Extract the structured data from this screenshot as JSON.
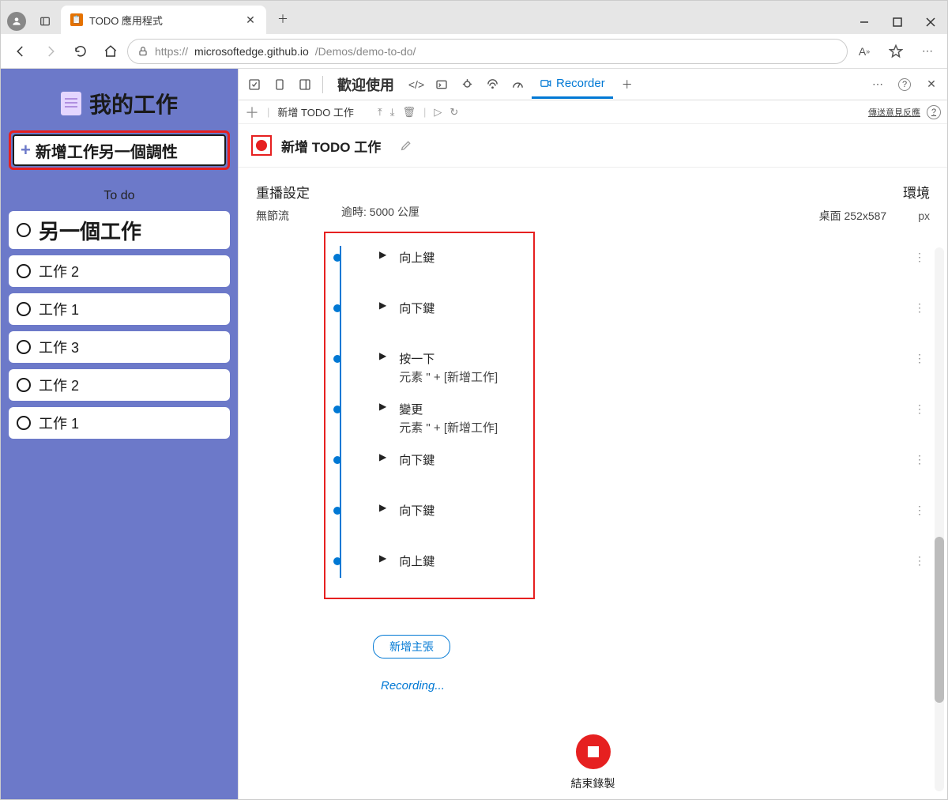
{
  "browser": {
    "tab_title": "TODO 應用程式",
    "url_scheme": "https://",
    "url_host": "microsoftedge.github.io",
    "url_path": "/Demos/demo-to-do/"
  },
  "todo": {
    "header": "我的工作",
    "add_text": "新增工作另一個調性",
    "section": "To do",
    "items": [
      {
        "label": "另一個工作",
        "featured": true
      },
      {
        "label": "工作 2",
        "featured": false
      },
      {
        "label": "工作 1",
        "featured": false
      },
      {
        "label": "工作 3",
        "featured": false
      },
      {
        "label": "工作 2",
        "featured": false
      },
      {
        "label": "工作 1",
        "featured": false
      }
    ]
  },
  "devtools": {
    "welcome_tab": "歡迎使用",
    "recorder_tab": "Recorder",
    "sub_label": "新增 TODO 工作",
    "feedback": "傳送意見反應",
    "recording_name": "新增 TODO 工作",
    "replay_settings_label": "重播設定",
    "no_throttle": "無節流",
    "timeout": "逾時: 5000 公厘",
    "env_label": "環境",
    "env_desktop": "桌面",
    "env_size": "252x587",
    "env_unit": "px",
    "steps": [
      {
        "text": "向上鍵",
        "sub": ""
      },
      {
        "text": "向下鍵",
        "sub": ""
      },
      {
        "text": "按一下",
        "sub": "元素 \" +      [新增工作]"
      },
      {
        "text": "變更",
        "sub": "元素 \" +      [新增工作]"
      },
      {
        "text": "向下鍵",
        "sub": ""
      },
      {
        "text": "向下鍵",
        "sub": ""
      },
      {
        "text": "向上鍵",
        "sub": ""
      }
    ],
    "add_assertion": "新增主張",
    "recording_status": "Recording...",
    "end_recording": "結束錄製"
  }
}
